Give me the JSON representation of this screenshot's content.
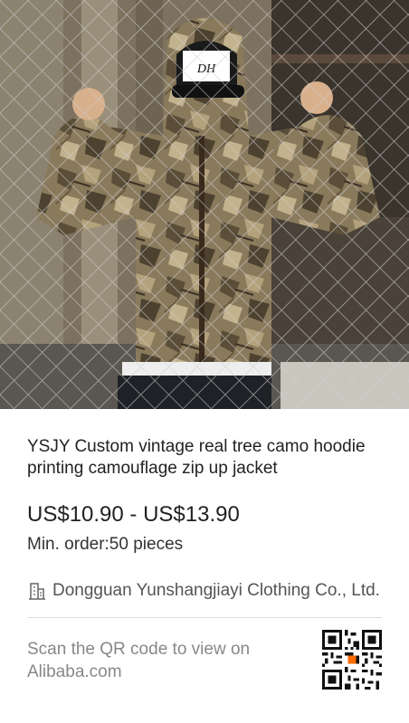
{
  "product": {
    "image_alt": "Person wearing camo zip-up hoodie in front of chain-link fence",
    "cap_text": "DH",
    "title": "YSJY Custom vintage real tree camo hoodie printing camouflage zip up jacket",
    "price": "US$10.90 - US$13.90",
    "min_order": "Min. order:50 pieces"
  },
  "supplier": {
    "icon": "building-icon",
    "name": "Dongguan Yunshangjiayi Clothing Co., Ltd."
  },
  "footer": {
    "scan_text": "Scan the QR code to view on Alibaba.com",
    "qr_icon": "qr-code-icon",
    "qr_accent": "#ff6a00"
  }
}
